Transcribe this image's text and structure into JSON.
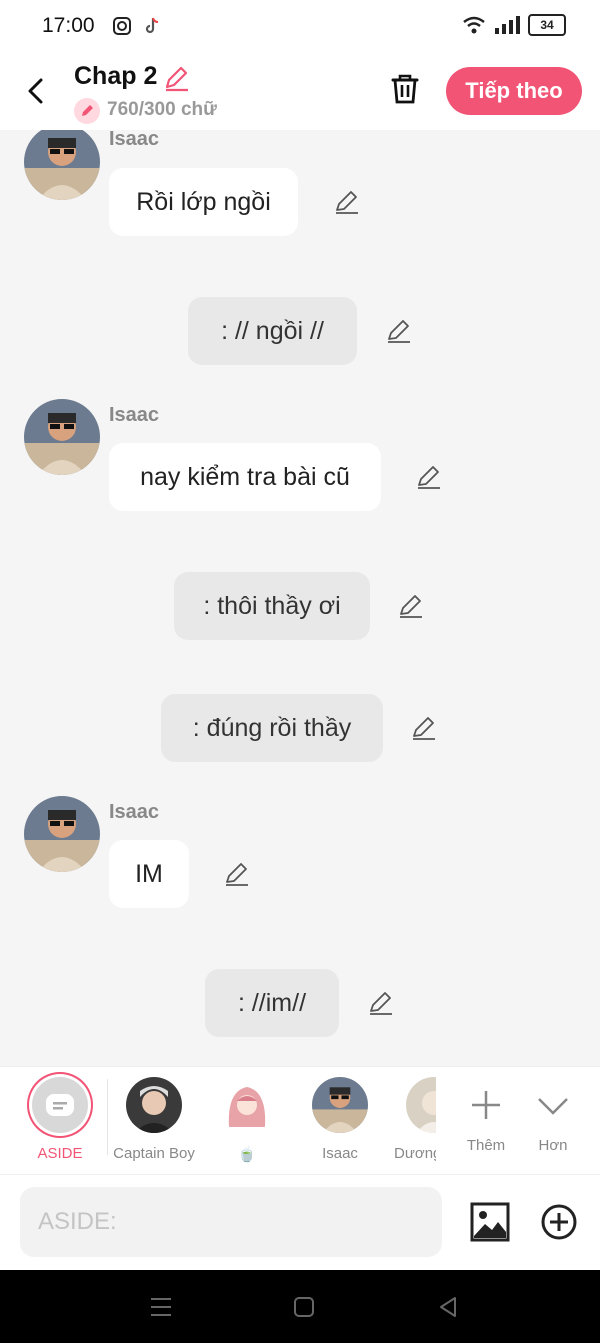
{
  "status": {
    "time": "17:00",
    "battery": "34"
  },
  "header": {
    "title": "Chap 2",
    "word_count": "760/300 chữ",
    "next_label": "Tiếp theo"
  },
  "messages": [
    {
      "type": "char",
      "name": "Isaac",
      "text": "Rồi lớp ngồi"
    },
    {
      "type": "aside",
      "text": ": // ngồi //"
    },
    {
      "type": "char",
      "name": "Isaac",
      "text": "nay kiểm tra bài cũ"
    },
    {
      "type": "aside",
      "text": ": thôi thầy ơi"
    },
    {
      "type": "aside",
      "text": ": đúng rồi thầy"
    },
    {
      "type": "char",
      "name": "Isaac",
      "text": "IM"
    },
    {
      "type": "aside",
      "text": ": //im//"
    }
  ],
  "characters": [
    {
      "label": "ASIDE"
    },
    {
      "label": "Captain Boy"
    },
    {
      "label": "🍵"
    },
    {
      "label": "Isaac"
    },
    {
      "label": "Dương"
    },
    {
      "label": "Thêm"
    },
    {
      "label": "Hơn"
    }
  ],
  "input": {
    "placeholder": "ASIDE:"
  },
  "colors": {
    "accent": "#f25476",
    "background": "#f5f5f5"
  },
  "icons": [
    "back-icon",
    "edit-icon",
    "trash-icon",
    "image-icon",
    "plus-circle-icon",
    "plus-icon",
    "chevron-down-icon"
  ]
}
